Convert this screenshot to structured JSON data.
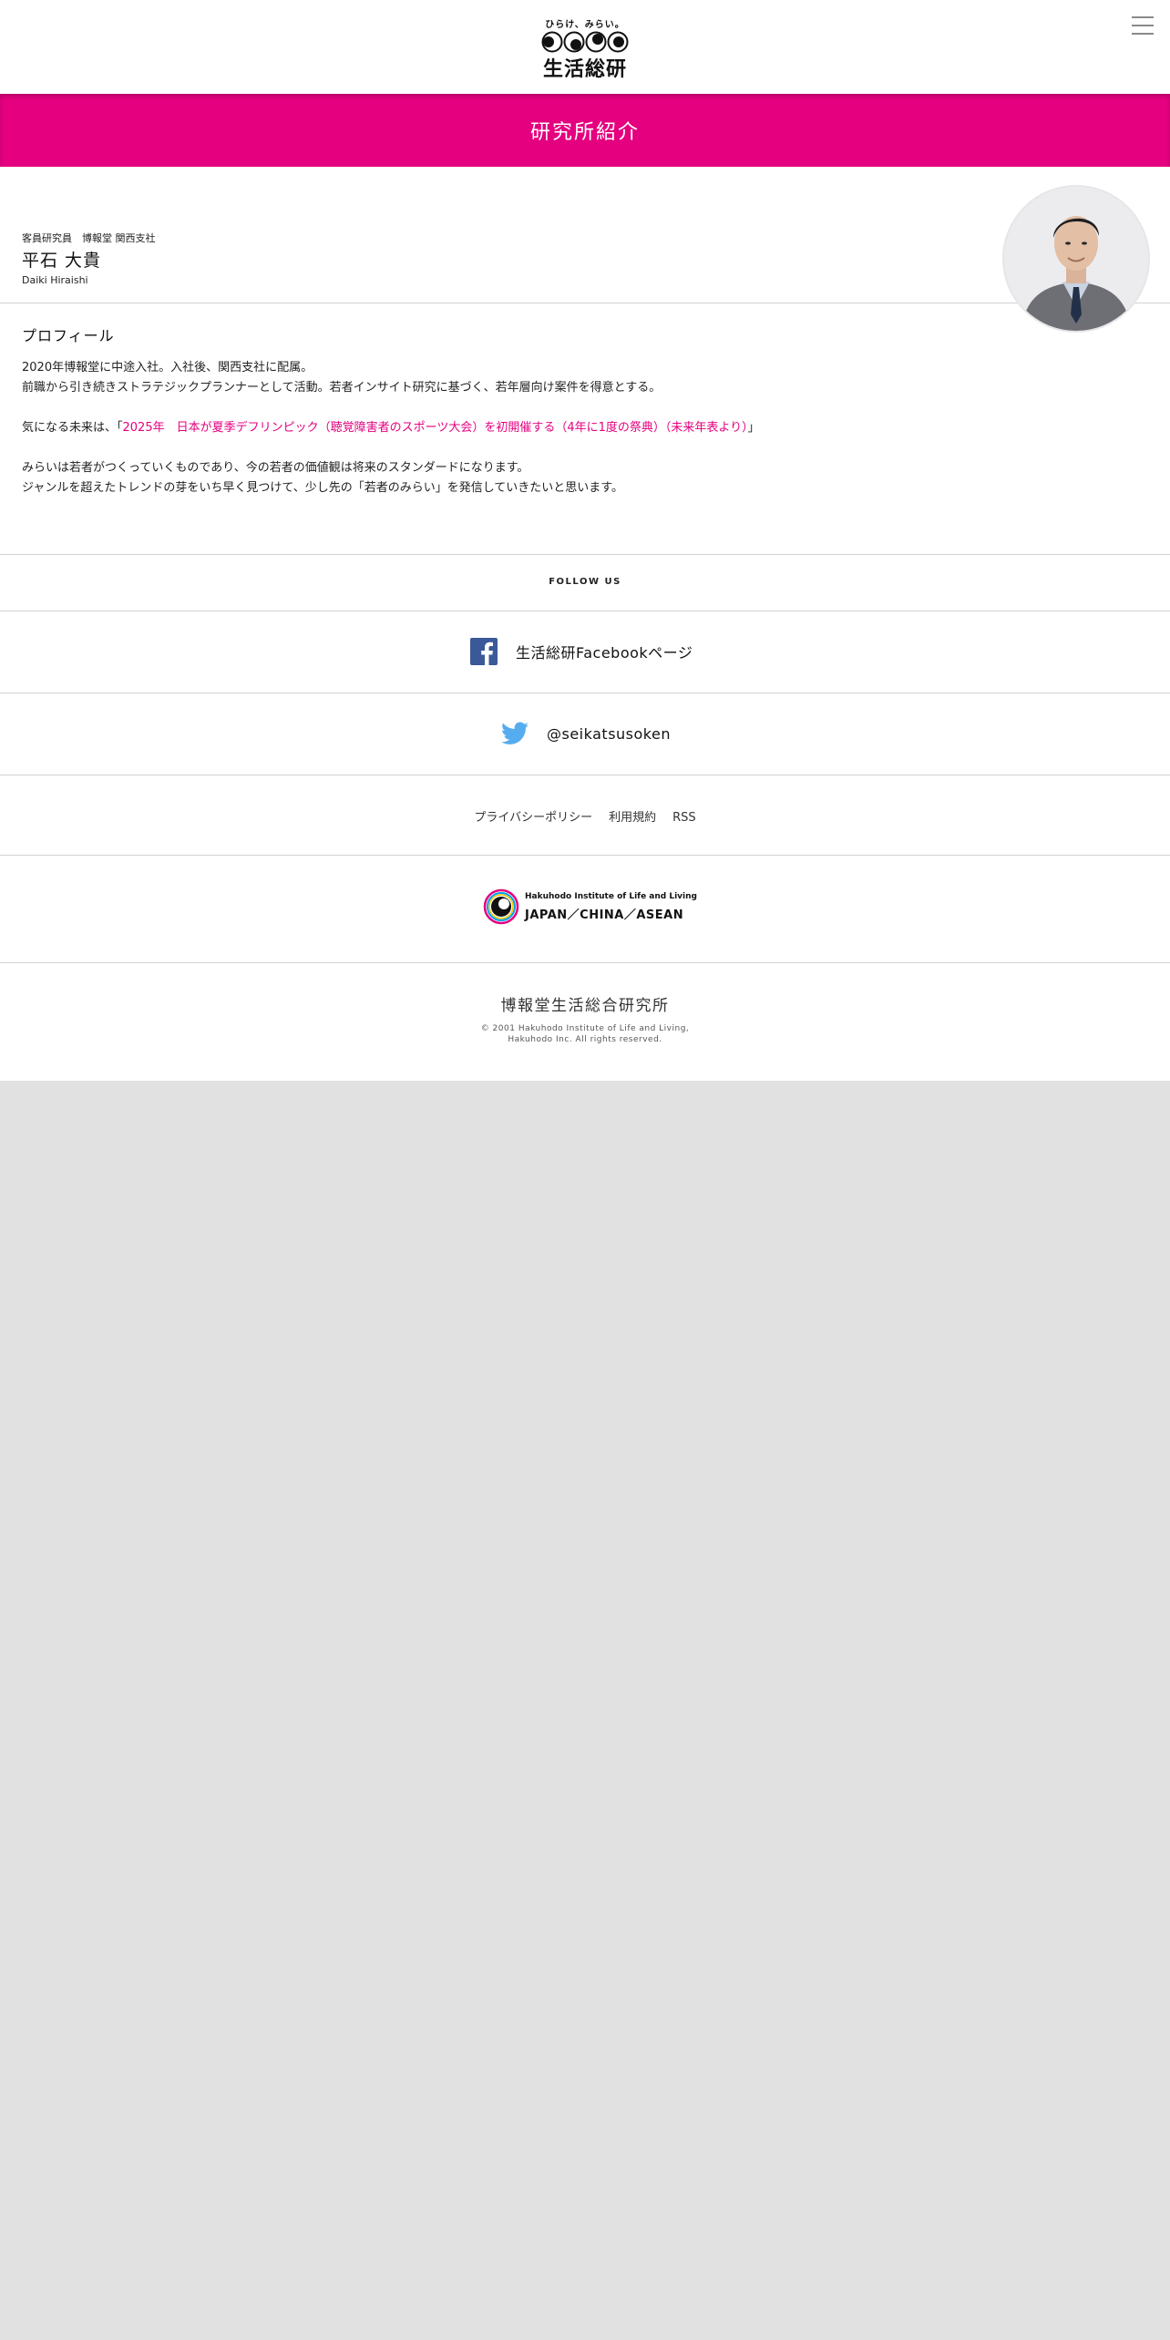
{
  "header": {
    "logo_tagline": "ひらけ、みらい。",
    "logo_name": "生活総研",
    "menu_icon": "hamburger-menu-icon"
  },
  "title_band": {
    "title": "研究所紹介",
    "color": "#e4007f"
  },
  "profile": {
    "role": "客員研究員　博報堂 関西支社",
    "name": "平石 大貴",
    "name_roman": "Daiki Hiraishi",
    "section_title": "プロフィール",
    "paragraph1_line1": "2020年博報堂に中途入社。入社後、関西支社に配属。",
    "paragraph1_line2": "前職から引き続きストラテジックプランナーとして活動。若者インサイト研究に基づく、若年層向け案件を得意とする。",
    "paragraph2_prefix": "気になる未来は、「",
    "paragraph2_link": "2025年　日本が夏季デフリンピック（聴覚障害者のスポーツ大会）を初開催する（4年に1度の祭典）（未来年表より）",
    "paragraph2_suffix": "」",
    "paragraph3_line1": "みらいは若者がつくっていくものであり、今の若者の価値観は将来のスタンダードになります。",
    "paragraph3_line2": "ジャンルを超えたトレンドの芽をいち早く見つけて、少し先の「若者のみらい」を発信していきたいと思います。"
  },
  "footer": {
    "follow_label": "FOLLOW US",
    "facebook_label": "生活総研Facebookページ",
    "twitter_label": "@seikatsusoken",
    "facebook_color": "#3b5998",
    "twitter_color": "#55acee",
    "links": [
      "プライバシーポリシー",
      "利用規約",
      "RSS"
    ],
    "brand_line1": "Hakuhodo Institute of Life and Living",
    "brand_line2": "JAPAN／CHINA／ASEAN",
    "org_name": "博報堂生活総合研究所",
    "copyright_line1": "© 2001 Hakuhodo Institute of Life and Living,",
    "copyright_line2": "Hakuhodo Inc. All rights reserved."
  }
}
